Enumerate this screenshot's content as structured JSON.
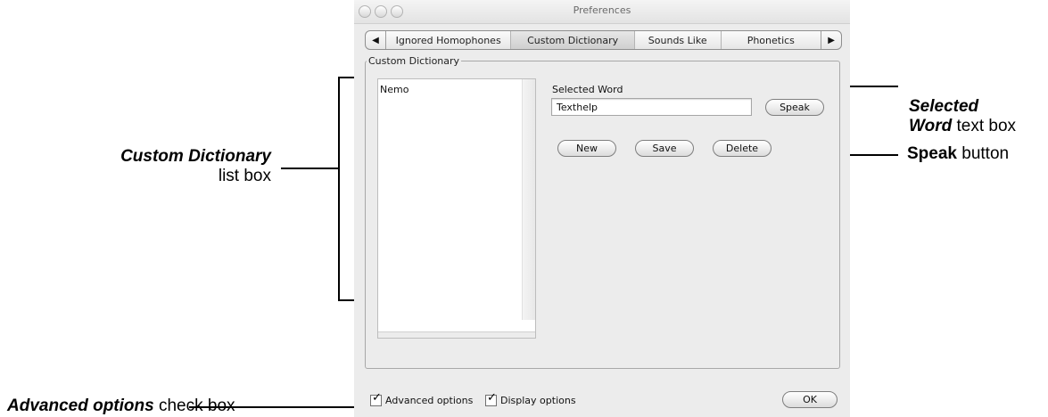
{
  "window": {
    "title": "Preferences"
  },
  "tabs": [
    {
      "label": "Ignored Homophones",
      "selected": false
    },
    {
      "label": "Custom Dictionary",
      "selected": true
    },
    {
      "label": "Sounds Like",
      "selected": false
    },
    {
      "label": "Phonetics",
      "selected": false
    }
  ],
  "group": {
    "label": "Custom Dictionary"
  },
  "list": {
    "items": [
      "Nemo"
    ]
  },
  "selected_word": {
    "label": "Selected Word",
    "value": "Texthelp"
  },
  "buttons": {
    "speak": "Speak",
    "new": "New",
    "save": "Save",
    "delete": "Delete",
    "ok": "OK"
  },
  "checkboxes": {
    "advanced": {
      "label": "Advanced options",
      "checked": true
    },
    "display": {
      "label": "Display options",
      "checked": true
    }
  },
  "callouts": {
    "selected_word_line1": "Selected",
    "selected_word_bold2": "Word",
    "selected_word_rest2": " text box",
    "speak_bold": "Speak",
    "speak_rest": " button",
    "custom_dict_bold": "Custom Dictionary",
    "custom_dict_rest": "list box",
    "advanced_bold": "Advanced options",
    "advanced_rest": " check box"
  }
}
